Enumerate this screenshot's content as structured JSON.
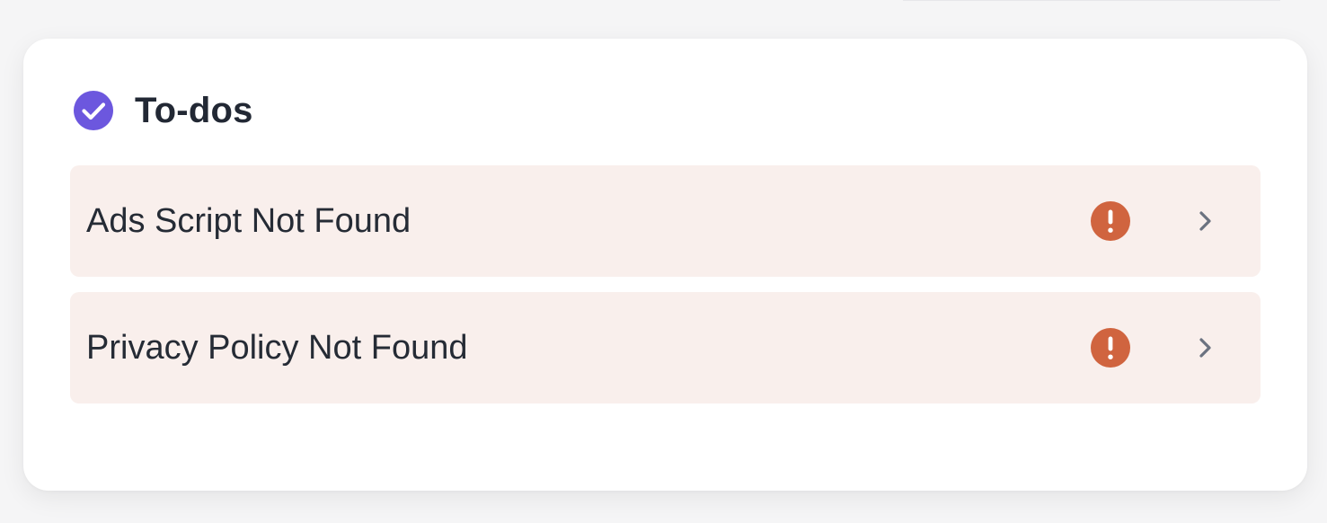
{
  "todos_card": {
    "title": "To-dos",
    "icon": "check-circle-icon",
    "items": [
      {
        "label": "Ads Script Not Found",
        "status_icon": "alert-icon",
        "action_icon": "chevron-right-icon"
      },
      {
        "label": "Privacy Policy Not Found",
        "status_icon": "alert-icon",
        "action_icon": "chevron-right-icon"
      }
    ]
  },
  "colors": {
    "accent": "#6c57de",
    "alert": "#d0643f",
    "item_background": "#f9efec",
    "text": "#252b35",
    "chevron": "#6b7280"
  }
}
